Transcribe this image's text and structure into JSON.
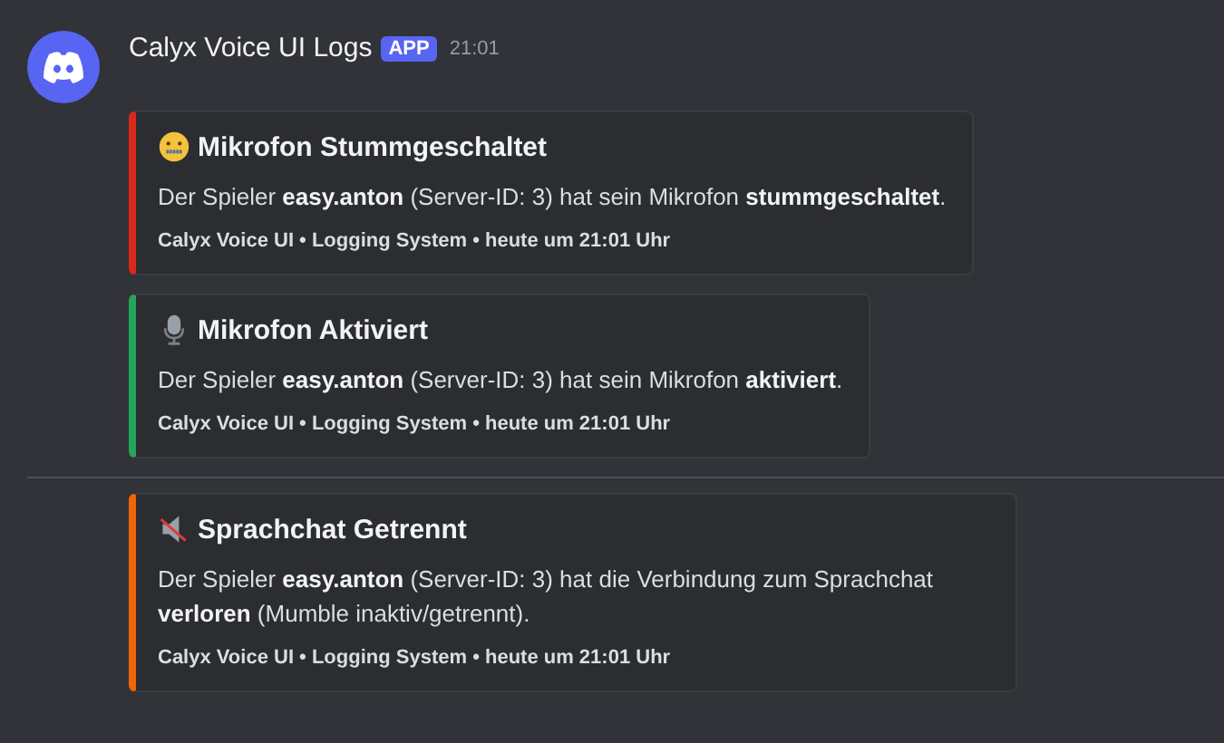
{
  "message": {
    "author": "Calyx Voice UI Logs",
    "badge": "APP",
    "time": "21:01"
  },
  "embeds": [
    {
      "kind": "zipper-face",
      "title": "Mikrofon Stummgeschaltet",
      "color": "#da291c",
      "description": "Der Spieler **easy.anton** (Server-ID: 3) hat sein Mikrofon **stummgeschaltet**.",
      "footer": "Calyx Voice UI • Logging System • heute um 21:01 Uhr"
    },
    {
      "kind": "microphone",
      "title": "Mikrofon Aktiviert",
      "color": "#23a55a",
      "description": "Der Spieler **easy.anton** (Server-ID: 3) hat sein Mikrofon **aktiviert**.",
      "footer": "Calyx Voice UI • Logging System • heute um 21:01 Uhr"
    },
    {
      "kind": "muted-speaker",
      "title": "Sprachchat Getrennt",
      "color": "#f0650a",
      "description": "Der Spieler **easy.anton** (Server-ID: 3) hat die Verbindung zum Sprachchat **verloren** (Mumble inaktiv/getrennt).",
      "footer": "Calyx Voice UI • Logging System • heute um 21:01 Uhr",
      "divider_before": true
    }
  ]
}
